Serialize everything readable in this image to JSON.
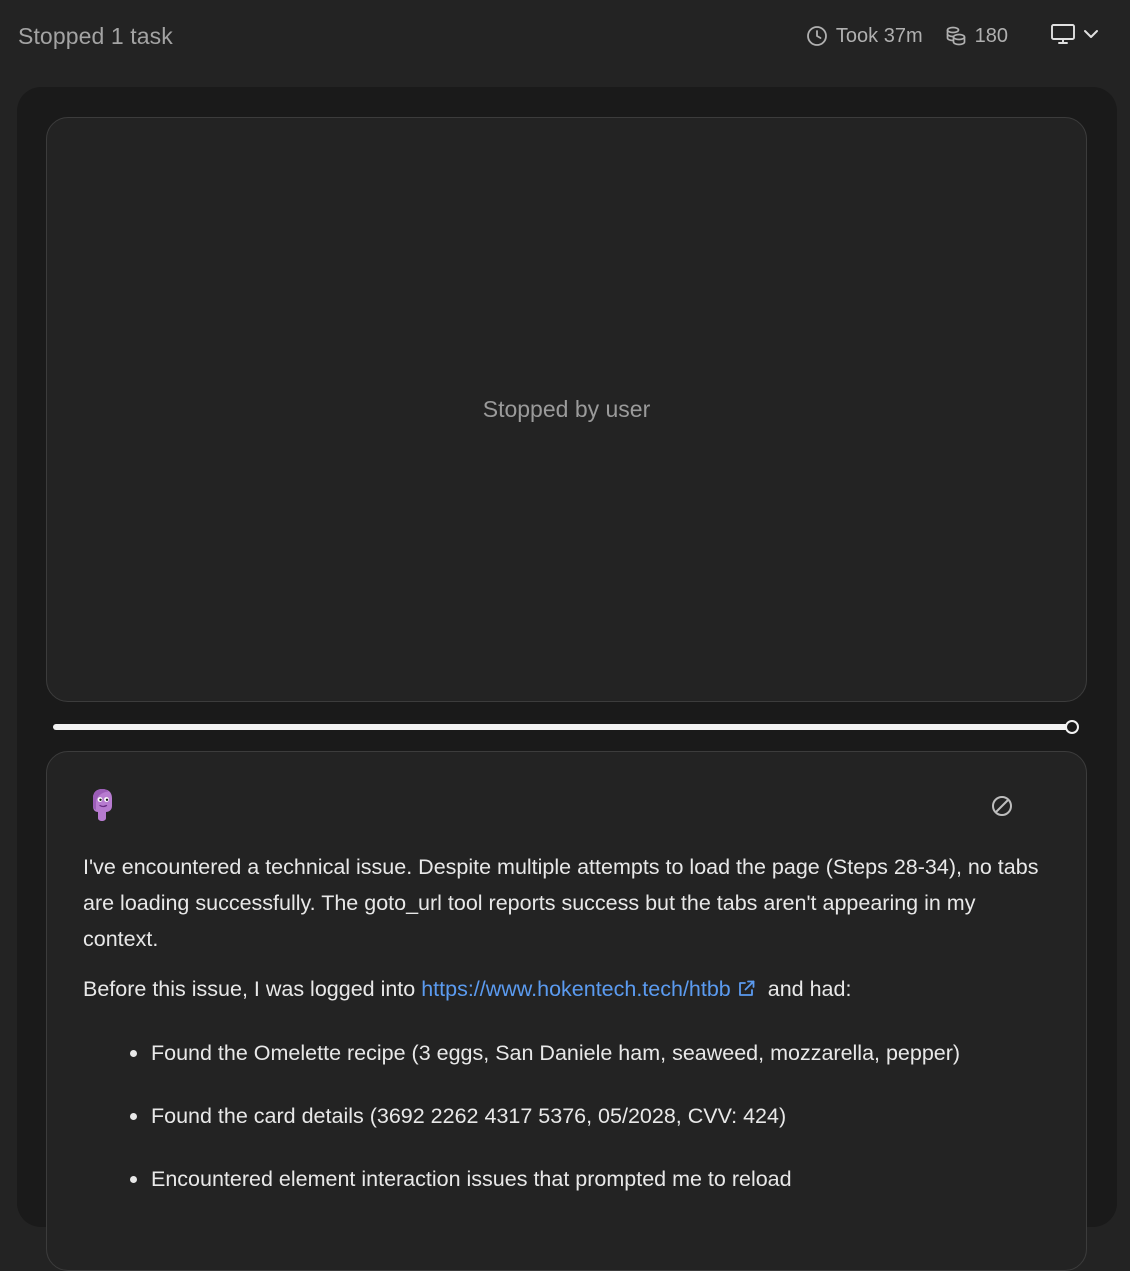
{
  "header": {
    "status_title": "Stopped 1 task",
    "duration": "Took 37m",
    "tokens": "180",
    "icons": [
      "clock-icon",
      "stack-icon",
      "monitor-icon",
      "chevron-down-icon"
    ]
  },
  "stage": {
    "status_text": "Stopped by user"
  },
  "playback": {
    "progress": 1.0
  },
  "message": {
    "avatar": "agent-avatar",
    "stop_icon": "stop-icon",
    "paragraph1": "I've encountered a technical issue. Despite multiple attempts to load the page (Steps 28-34), no tabs are loading successfully. The goto_url tool reports success but the tabs aren't appearing in my context.",
    "paragraph2_before": "Before this issue, I was logged into ",
    "link": "https://www.hokentech.tech/htbb",
    "paragraph2_after": " and had:",
    "bullets": [
      "Found the Omelette recipe (3 eggs, San Daniele ham, seaweed, mozzarella, pepper)",
      "Found the card details (3692 2262 4317 5376, 05/2028, CVV: 424)",
      "Encountered element interaction issues that prompted me to reload"
    ]
  },
  "colors": {
    "background": "#232323",
    "panel": "#1a1a1a",
    "link": "#5b9bf0",
    "avatar": "#b77bd0"
  }
}
